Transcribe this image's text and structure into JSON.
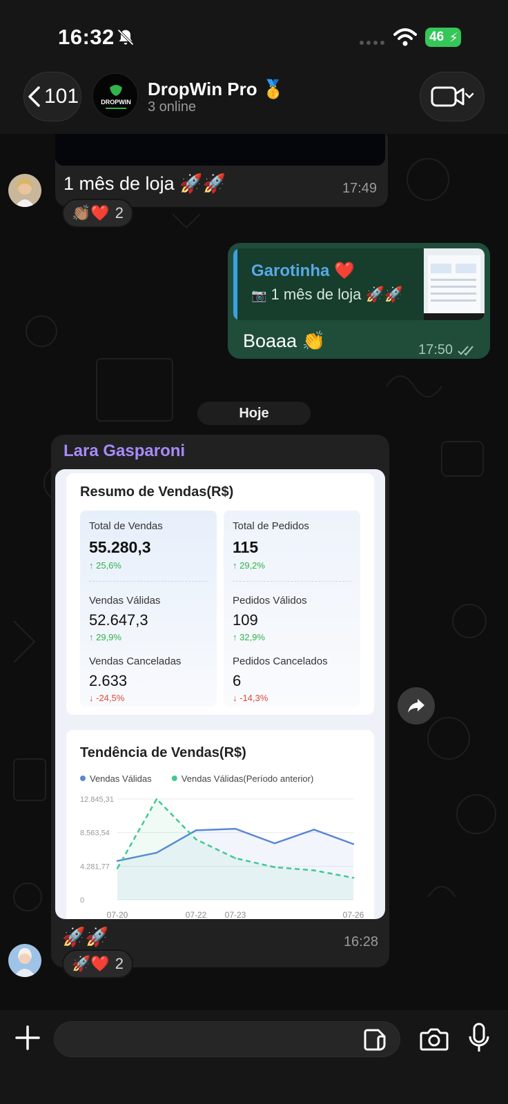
{
  "status_bar": {
    "time": "16:32",
    "battery": "46"
  },
  "header": {
    "back_count": "101",
    "group_name": "DropWin Pro",
    "group_name_badge": "🥇",
    "group_status": "3 online",
    "avatar_text": "DROPWIN"
  },
  "messages": [
    {
      "type": "incoming",
      "text": "1 mês de loja",
      "emojis": "🚀🚀",
      "time": "17:49",
      "reactions": {
        "emojis": "👏🏽❤️",
        "count": "2"
      }
    },
    {
      "type": "outgoing",
      "quote": {
        "name": "Garotinha",
        "name_emoji": "❤️",
        "text": "1 mês de loja",
        "text_emojis": "🚀🚀"
      },
      "text": "Boaaa",
      "emojis": "👏",
      "time": "17:50"
    }
  ],
  "date_separator": "Hoje",
  "shared_report": {
    "sender": "Lara Gasparoni",
    "summary_title": "Resumo de Vendas(R$)",
    "left_column": {
      "total_label": "Total de Vendas",
      "total_value": "55.280,3",
      "total_change": "↑ 25,6%",
      "valid_label": "Vendas Válidas",
      "valid_value": "52.647,3",
      "valid_change": "↑ 29,9%",
      "cancel_label": "Vendas Canceladas",
      "cancel_value": "2.633",
      "cancel_change": "↓ -24,5%"
    },
    "right_column": {
      "total_label": "Total de Pedidos",
      "total_value": "115",
      "total_change": "↑ 29,2%",
      "valid_label": "Pedidos Válidos",
      "valid_value": "109",
      "valid_change": "↑ 32,9%",
      "cancel_label": "Pedidos Cancelados",
      "cancel_value": "6",
      "cancel_change": "↓ -14,3%"
    },
    "trend_title": "Tendência de Vendas(R$)",
    "chart_data": {
      "type": "line",
      "title": "Tendência de Vendas(R$)",
      "x": [
        "07-20",
        "07-21",
        "07-22",
        "07-23",
        "07-24",
        "07-25",
        "07-26"
      ],
      "x_tick_labels": [
        "07-20",
        "07-22",
        "07-23",
        "07-26"
      ],
      "y_ticks": [
        "12.845,31",
        "8.563,54",
        "4.281,77",
        "0"
      ],
      "ylim": [
        0,
        12845.31
      ],
      "series": [
        {
          "name": "Vendas Válidas",
          "color": "#5b86d6",
          "style": "solid",
          "values": [
            4950,
            6000,
            8850,
            9050,
            7200,
            8950,
            7100
          ]
        },
        {
          "name": "Vendas Válidas(Período anterior)",
          "color": "#3fc98e",
          "style": "dashed",
          "values": [
            4000,
            12845,
            7700,
            5300,
            4150,
            3750,
            2800
          ]
        }
      ],
      "legend": "top-left",
      "grid": true
    },
    "caption_emojis": "🚀🚀",
    "time": "16:28",
    "reactions": {
      "emojis": "🚀❤️",
      "count": "2"
    }
  },
  "input_bar": {
    "placeholder": ""
  },
  "colors": {
    "outgoing_bubble": "#1f4d3a",
    "incoming_bubble": "#212121",
    "sender_name": "#a78bfa",
    "quote_name": "#58a9e8"
  }
}
